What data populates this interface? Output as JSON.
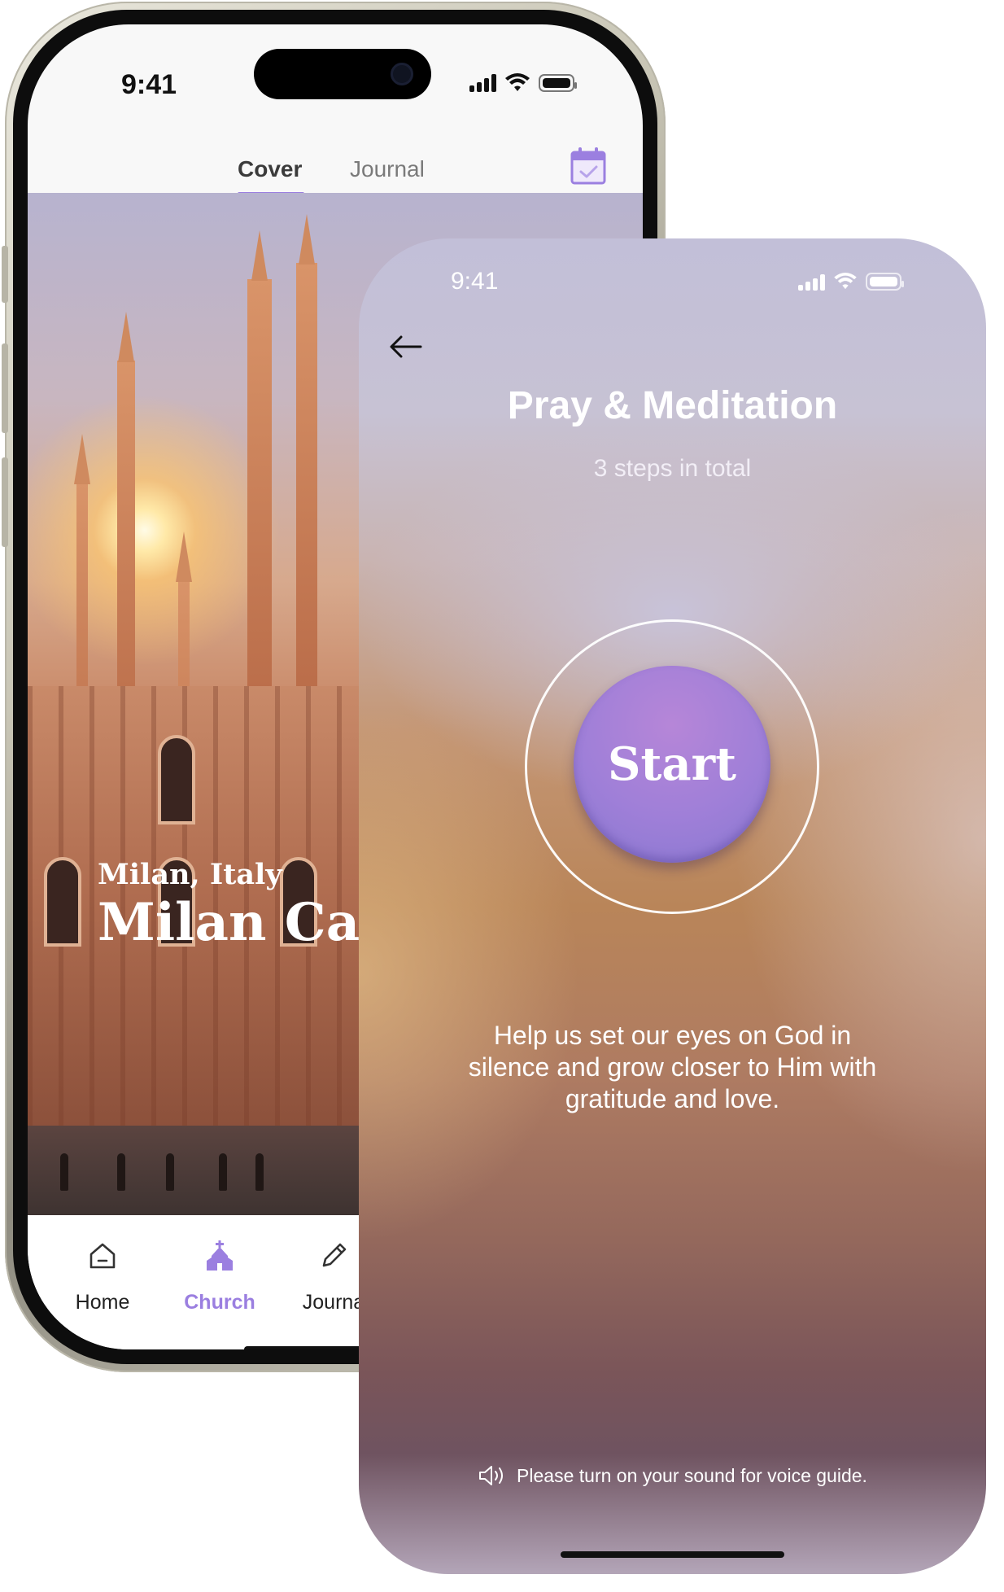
{
  "back_phone": {
    "status": {
      "time": "9:41"
    },
    "tabs": [
      {
        "label": "Cover",
        "active": true
      },
      {
        "label": "Journal",
        "active": false
      }
    ],
    "hero": {
      "subtitle": "Milan, Italy",
      "title": "Milan Cath"
    },
    "bottom_nav": [
      {
        "label": "Home",
        "icon": "home-icon",
        "active": false
      },
      {
        "label": "Church",
        "icon": "church-icon",
        "active": true
      },
      {
        "label": "Journa",
        "icon": "pencil-icon",
        "active": false
      }
    ],
    "colors": {
      "accent": "#9b7fe0",
      "text": "#3b3b3b",
      "muted": "#7a7a7a"
    }
  },
  "front_phone": {
    "status": {
      "time": "9:41"
    },
    "title": "Pray & Meditation",
    "subtitle": "3 steps in total",
    "start_label": "Start",
    "description": "Help us set our eyes on God in silence and grow closer to Him with gratitude and love.",
    "sound_hint": "Please turn on your sound for voice guide.",
    "colors": {
      "start_button": "#9f7fd8",
      "text": "#ffffff"
    }
  }
}
